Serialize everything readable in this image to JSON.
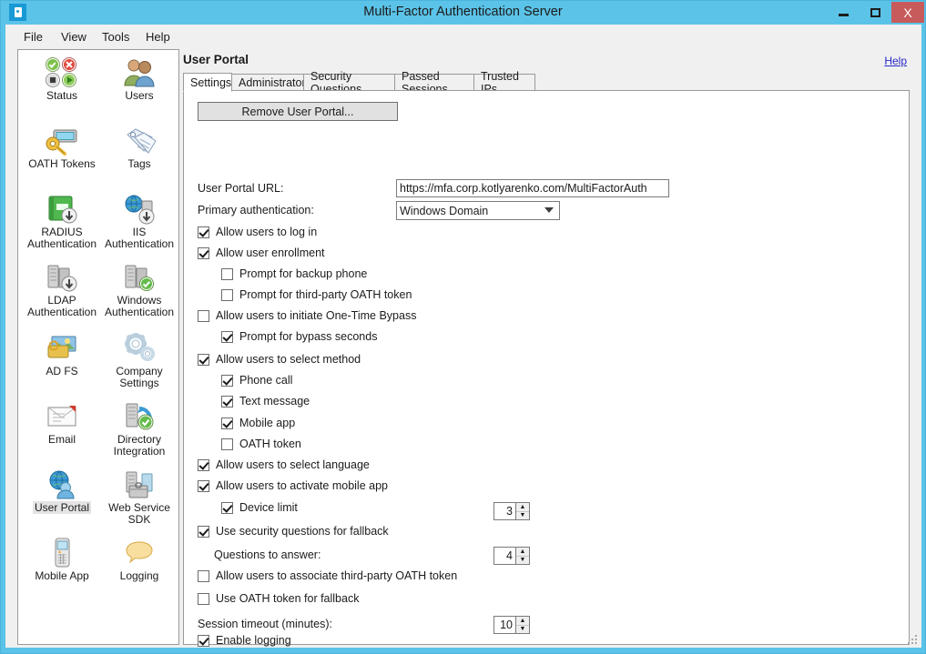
{
  "window": {
    "title": "Multi-Factor Authentication Server",
    "app_icon": "lock-icon",
    "minimize_label": "Minimize",
    "maximize_label": "Maximize",
    "close_label": "X",
    "accent_color": "#5bc3e8",
    "close_color": "#c75b5b"
  },
  "menu": {
    "items": [
      {
        "label": "File"
      },
      {
        "label": "View"
      },
      {
        "label": "Tools"
      },
      {
        "label": "Help"
      }
    ]
  },
  "sidebar": {
    "items": [
      {
        "label": "Status",
        "icon": "status-badges-icon",
        "selected": false
      },
      {
        "label": "Users",
        "icon": "users-icon",
        "selected": false
      },
      {
        "label": "OATH Tokens",
        "icon": "oath-token-key-icon",
        "selected": false
      },
      {
        "label": "Tags",
        "icon": "tags-icon",
        "selected": false
      },
      {
        "label": "RADIUS Authentication",
        "icon": "radius-auth-icon",
        "selected": false
      },
      {
        "label": "IIS Authentication",
        "icon": "iis-auth-globe-icon",
        "selected": false
      },
      {
        "label": "LDAP Authentication",
        "icon": "ldap-auth-server-icon",
        "selected": false
      },
      {
        "label": "Windows Authentication",
        "icon": "windows-auth-server-icon",
        "selected": false
      },
      {
        "label": "AD FS",
        "icon": "adfs-icon",
        "selected": false
      },
      {
        "label": "Company Settings",
        "icon": "gears-icon",
        "selected": false
      },
      {
        "label": "Email",
        "icon": "email-envelope-icon",
        "selected": false
      },
      {
        "label": "Directory Integration",
        "icon": "directory-integration-icon",
        "selected": false
      },
      {
        "label": "User Portal",
        "icon": "user-portal-globe-icon",
        "selected": true
      },
      {
        "label": "Web Service SDK",
        "icon": "web-service-sdk-icon",
        "selected": false
      },
      {
        "label": "Mobile App",
        "icon": "mobile-phone-icon",
        "selected": false
      },
      {
        "label": "Logging",
        "icon": "logging-speech-icon",
        "selected": false
      }
    ]
  },
  "page": {
    "title": "User Portal",
    "help_label": "Help"
  },
  "tabs": [
    {
      "label": "Settings",
      "active": true
    },
    {
      "label": "Administrators",
      "active": false
    },
    {
      "label": "Security Questions",
      "active": false
    },
    {
      "label": "Passed Sessions",
      "active": false
    },
    {
      "label": "Trusted IPs",
      "active": false
    }
  ],
  "settings": {
    "remove_button_label": "Remove User Portal...",
    "url_label": "User Portal URL:",
    "url_value": "https://mfa.corp.kotlyarenko.com/MultiFactorAuth",
    "primary_auth_label": "Primary authentication:",
    "primary_auth_value": "Windows Domain",
    "checkboxes": [
      {
        "label": "Allow users to log in",
        "checked": true,
        "indent": 0
      },
      {
        "label": "Allow user enrollment",
        "checked": true,
        "indent": 0
      },
      {
        "label": "Prompt for backup phone",
        "checked": false,
        "indent": 1
      },
      {
        "label": "Prompt for third-party OATH token",
        "checked": false,
        "indent": 1
      },
      {
        "label": "Allow users to initiate One-Time Bypass",
        "checked": false,
        "indent": 0
      },
      {
        "label": "Prompt for bypass seconds",
        "checked": true,
        "indent": 1
      },
      {
        "label": "Allow users to select method",
        "checked": true,
        "indent": 0
      },
      {
        "label": "Phone call",
        "checked": true,
        "indent": 1
      },
      {
        "label": "Text message",
        "checked": true,
        "indent": 1
      },
      {
        "label": "Mobile app",
        "checked": true,
        "indent": 1
      },
      {
        "label": "OATH token",
        "checked": false,
        "indent": 1
      },
      {
        "label": "Allow users to select language",
        "checked": true,
        "indent": 0
      },
      {
        "label": "Allow users to activate mobile app",
        "checked": true,
        "indent": 0
      },
      {
        "label": "Device limit",
        "checked": true,
        "indent": 1
      },
      {
        "label": "Use security questions for fallback",
        "checked": true,
        "indent": 0
      }
    ],
    "questions_to_answer_label": "Questions to answer:",
    "questions_to_answer_value": "4",
    "checkboxes_tail": [
      {
        "label": "Allow users to associate third-party OATH token",
        "checked": false,
        "indent": 0
      },
      {
        "label": "Use OATH token for fallback",
        "checked": false,
        "indent": 0
      }
    ],
    "session_timeout_label": "Session timeout (minutes):",
    "session_timeout_value": "10",
    "enable_logging_label": "Enable logging",
    "enable_logging_checked": true,
    "device_limit_value": "3",
    "spin_up": "▲",
    "spin_down": "▼"
  }
}
